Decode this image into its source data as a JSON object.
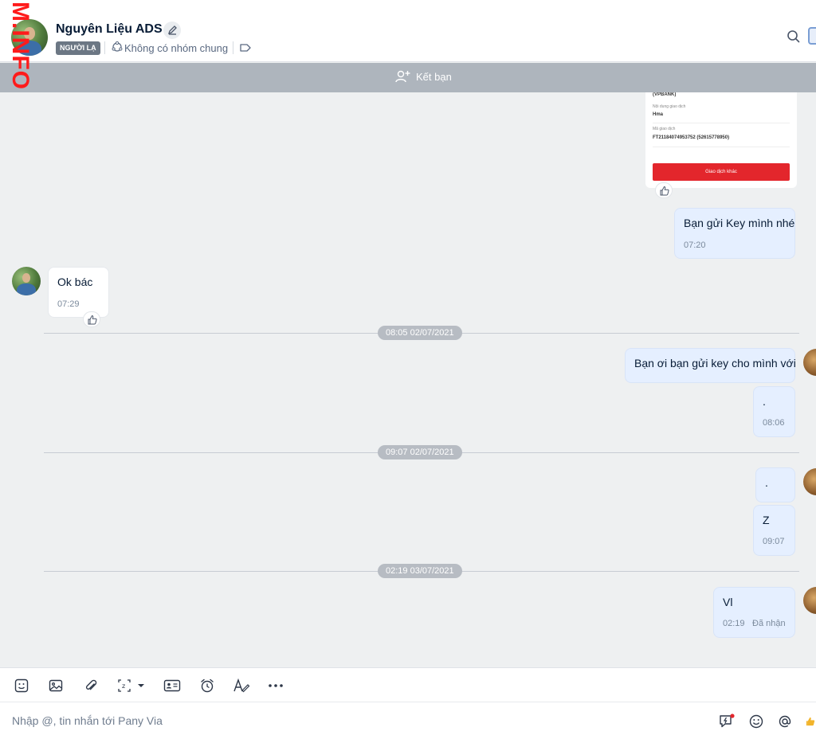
{
  "header": {
    "contact_name": "Nguyên Liệu ADS",
    "stranger_badge": "NGƯỜI LẠ",
    "groups_text": "Không có nhóm chung"
  },
  "add_friend": {
    "label": "Kết bạn"
  },
  "watermark": "M.INFO",
  "receipt": {
    "bank": "(VPBANK)",
    "content_label": "Nội dung giao dịch",
    "content_value": "Hma",
    "code_label": "Mã giao dịch",
    "code_value": "FT21184074953752 (52615778950)",
    "button": "Giao dịch khác"
  },
  "messages": [
    {
      "text": "Bạn gửi Key mình nhé",
      "time": "07:20"
    },
    {
      "text": "Ok bác",
      "time": "07:29"
    },
    {
      "text": "Bạn ơi bạn gửi key cho mình với"
    },
    {
      "text": ".",
      "time": "08:06"
    },
    {
      "text": "."
    },
    {
      "text": "Z",
      "time": "09:07"
    },
    {
      "text": "Vl",
      "time": "02:19",
      "status": "Đã nhận"
    }
  ],
  "dividers": [
    "08:05 02/07/2021",
    "09:07 02/07/2021",
    "02:19 03/07/2021"
  ],
  "composer": {
    "placeholder": "Nhập @, tin nhắn tới Pany Via"
  }
}
